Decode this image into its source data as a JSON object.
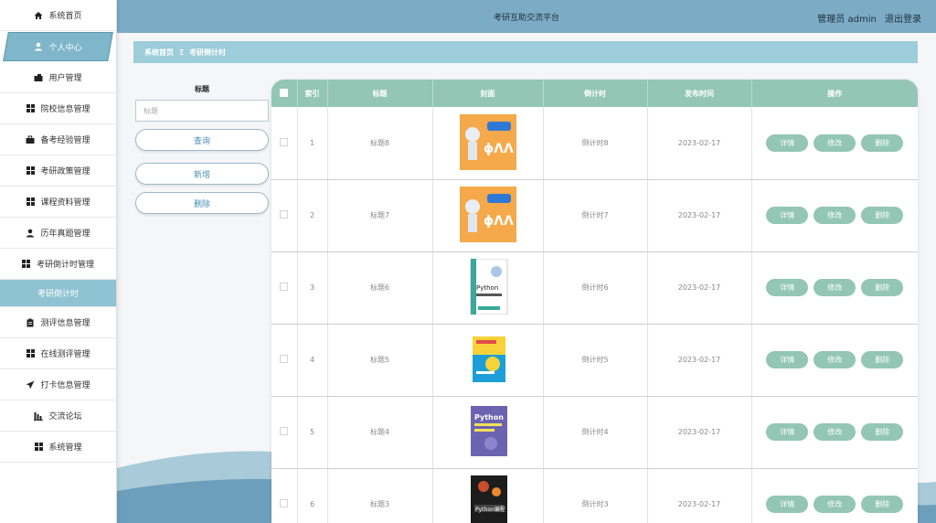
{
  "sidebar": {
    "items": [
      {
        "label": "系统首页"
      },
      {
        "label": "个人中心"
      },
      {
        "label": "用户管理"
      },
      {
        "label": "院校信息管理"
      },
      {
        "label": "备考经验管理"
      },
      {
        "label": "考研政策管理"
      },
      {
        "label": "课程资料管理"
      },
      {
        "label": "历年真题管理"
      },
      {
        "label": "考研倒计时管理"
      },
      {
        "label": "考研倒计时"
      },
      {
        "label": "测评信息管理"
      },
      {
        "label": "在线测评管理"
      },
      {
        "label": "打卡信息管理"
      },
      {
        "label": "交流论坛"
      },
      {
        "label": "系统管理"
      }
    ]
  },
  "topbar": {
    "title": "考研互助交流平台",
    "user": "管理员 admin",
    "logout": "退出登录"
  },
  "breadcrumb": {
    "home": "系统首页",
    "sep": "Ξ",
    "current": "考研倒计时"
  },
  "search": {
    "label": "标题",
    "placeholder": "标题",
    "query_button": "查询",
    "add_button": "新增",
    "delete_button": "删除"
  },
  "table": {
    "headers": [
      "",
      "索引",
      "标题",
      "封面",
      "倒计时",
      "发布时间",
      "操作"
    ],
    "rows": [
      {
        "index": "1",
        "title": "标题8",
        "countdown": "倒计时8",
        "date": "2023-02-17",
        "cover": "orange"
      },
      {
        "index": "2",
        "title": "标题7",
        "countdown": "倒计时7",
        "date": "2023-02-17",
        "cover": "orange"
      },
      {
        "index": "3",
        "title": "标题6",
        "countdown": "倒计时6",
        "date": "2023-02-17",
        "cover": "python-white"
      },
      {
        "index": "4",
        "title": "标题5",
        "countdown": "倒计时5",
        "date": "2023-02-17",
        "cover": "blue-yellow"
      },
      {
        "index": "5",
        "title": "标题4",
        "countdown": "倒计时4",
        "date": "2023-02-17",
        "cover": "python-purple"
      },
      {
        "index": "6",
        "title": "标题3",
        "countdown": "倒计时3",
        "date": "2023-02-17",
        "cover": "python-dark"
      }
    ],
    "actions": {
      "detail": "详情",
      "edit": "修改",
      "delete": "删除"
    }
  },
  "colors": {
    "accent": "#7cabc6",
    "table_header": "#93c6b4",
    "breadcrumb": "#9dccda"
  }
}
